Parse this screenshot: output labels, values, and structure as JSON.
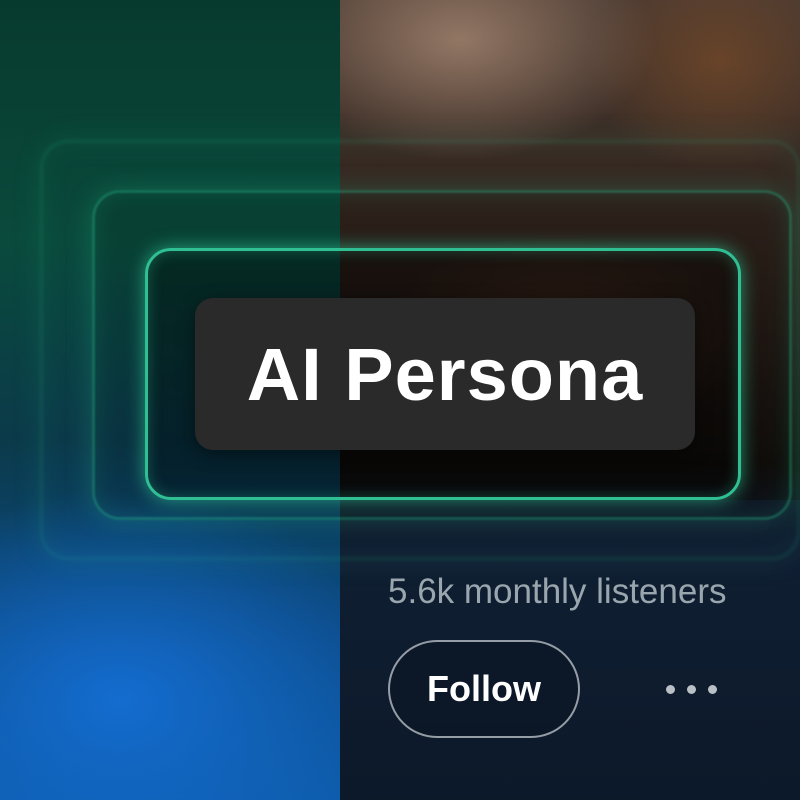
{
  "artist": {
    "name": "AI Persona",
    "monthly_listeners": "5.6k monthly listeners"
  },
  "actions": {
    "follow_label": "Follow",
    "more_icon": "more-horizontal-icon"
  },
  "colors": {
    "accent_glow": "#2fbf92",
    "title_box": "#2a2a2a",
    "text_primary": "#ffffff",
    "text_secondary": "#9aa6ad"
  }
}
